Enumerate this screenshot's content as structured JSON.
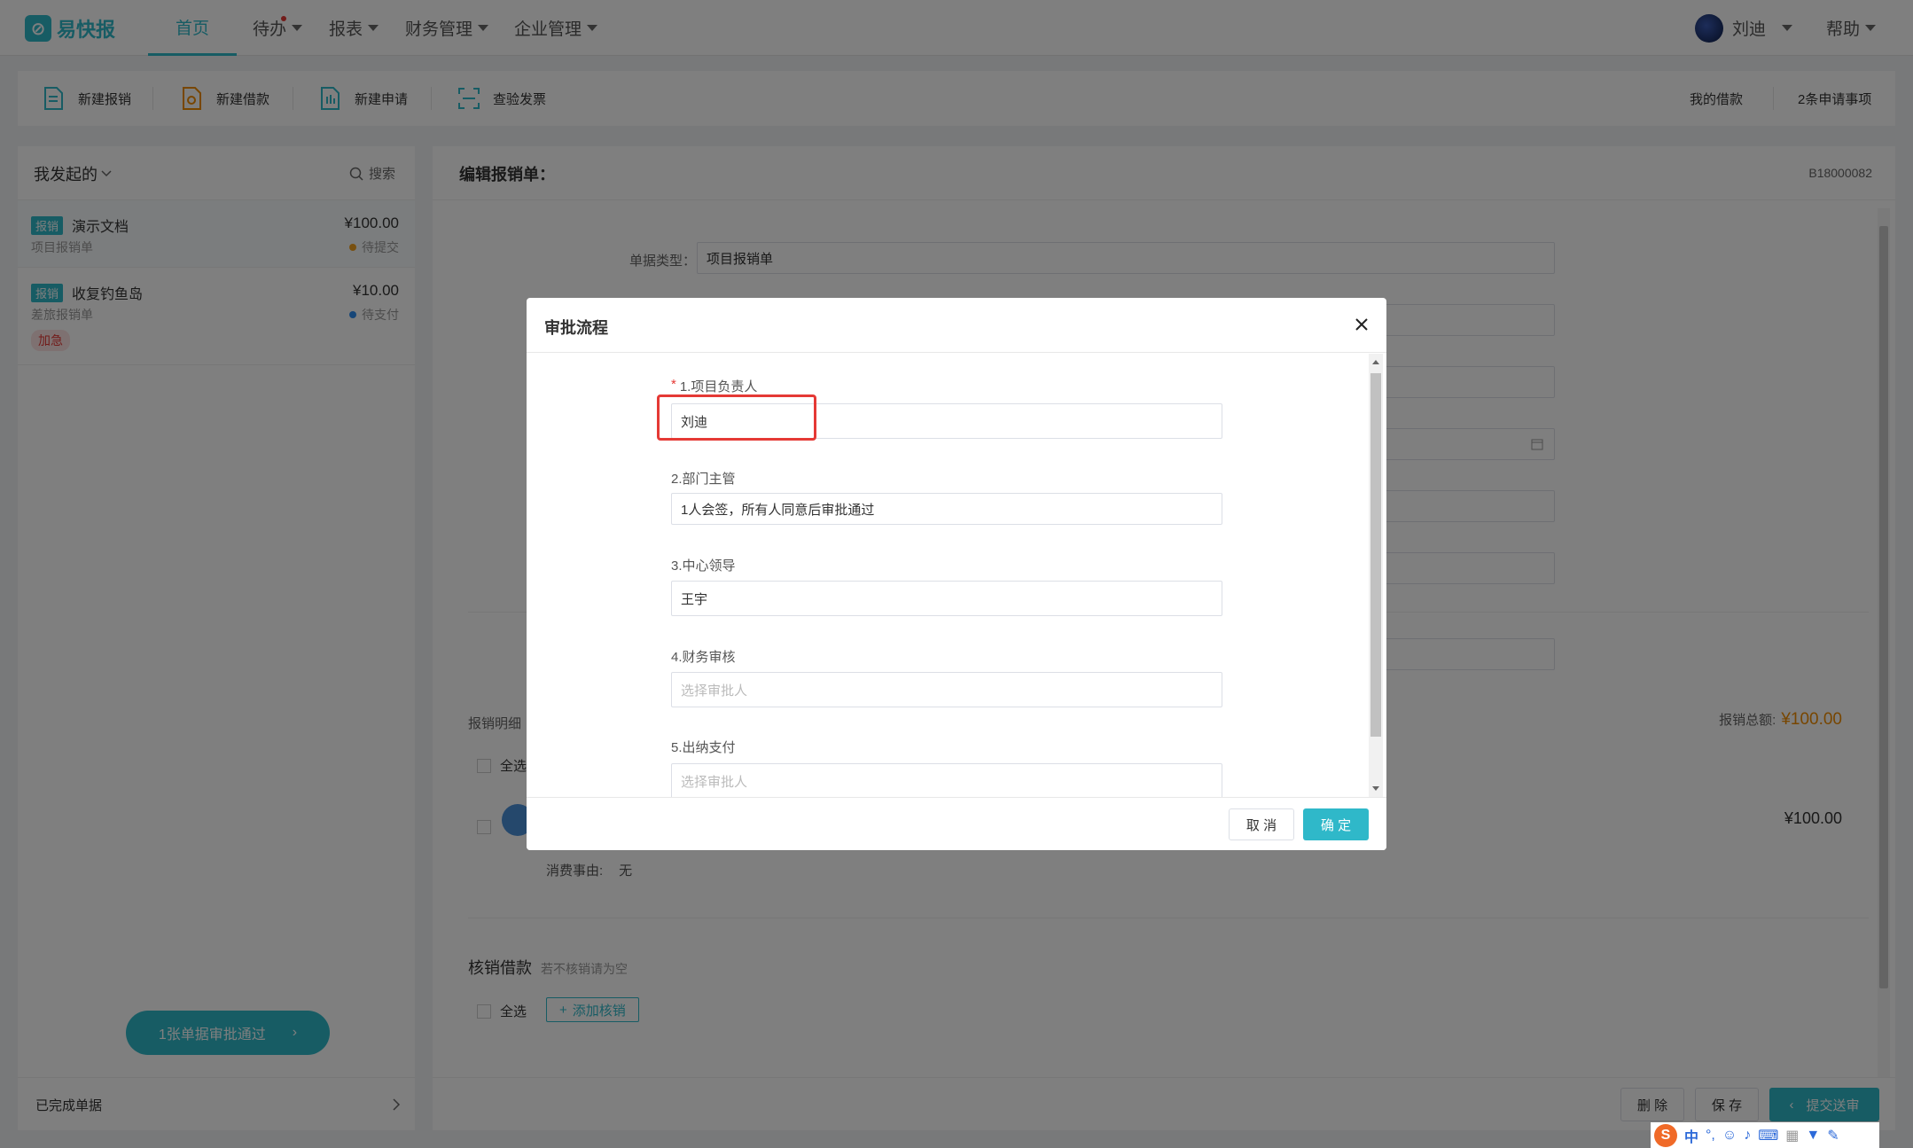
{
  "app": {
    "logo_mark": "⊘",
    "logo_name": "易快报"
  },
  "nav": {
    "home": "首页",
    "todo": "待办",
    "reports": "报表",
    "finance": "财务管理",
    "enterprise": "企业管理",
    "user": "刘迪",
    "help": "帮助"
  },
  "toolbar": {
    "new_reimburse": "新建报销",
    "new_loan": "新建借款",
    "new_request": "新建申请",
    "check_invoice": "查验发票",
    "my_loans": "我的借款",
    "pending_requests": "2条申请事项"
  },
  "left": {
    "filter": "我发起的",
    "search": "搜索",
    "items": [
      {
        "tag": "报销",
        "title": "演示文档",
        "amount": "¥100.00",
        "type": "项目报销单",
        "status": "待提交",
        "status_color": "#f0a020"
      },
      {
        "tag": "报销",
        "title": "收复钓鱼岛",
        "amount": "¥10.00",
        "type": "差旅报销单",
        "status": "待支付",
        "status_color": "#2d8cf0",
        "urgent": "加急"
      }
    ],
    "approved_pill": "1张单据审批通过",
    "completed": "已完成单据"
  },
  "main": {
    "title": "编辑报销单：",
    "doc_no": "B18000082",
    "doc_type_label": "单据类型：",
    "doc_type_value": "项目报销单",
    "details_label": "报销明细",
    "select_all": "全选",
    "total_label": "报销总额:",
    "total_value": "¥100.00",
    "row_amount": "¥100.00",
    "reason_label": "消费事由:",
    "reason_value": "无",
    "writeoff_title": "核销借款",
    "writeoff_hint": "若不核销请为空",
    "add_writeoff": "添加核销",
    "delete": "删 除",
    "save": "保 存",
    "submit": "提交送审"
  },
  "modal": {
    "title": "审批流程",
    "steps": [
      {
        "label": "1.项目负责人",
        "required": "*",
        "value": "刘迪",
        "placeholder": false
      },
      {
        "label": "2.部门主管",
        "value": "1人会签，所有人同意后审批通过",
        "placeholder": false
      },
      {
        "label": "3.中心领导",
        "value": "王宇",
        "placeholder": false
      },
      {
        "label": "4.财务审核",
        "value": "选择审批人",
        "placeholder": true
      },
      {
        "label": "5.出纳支付",
        "value": "选择审批人",
        "placeholder": true
      }
    ],
    "cancel": "取 消",
    "ok": "确 定"
  },
  "ime": {
    "label": "S",
    "mode": "中"
  },
  "colors": {
    "accent": "#2fb8c9",
    "highlight": "#e53935",
    "amount": "#f08c00"
  }
}
